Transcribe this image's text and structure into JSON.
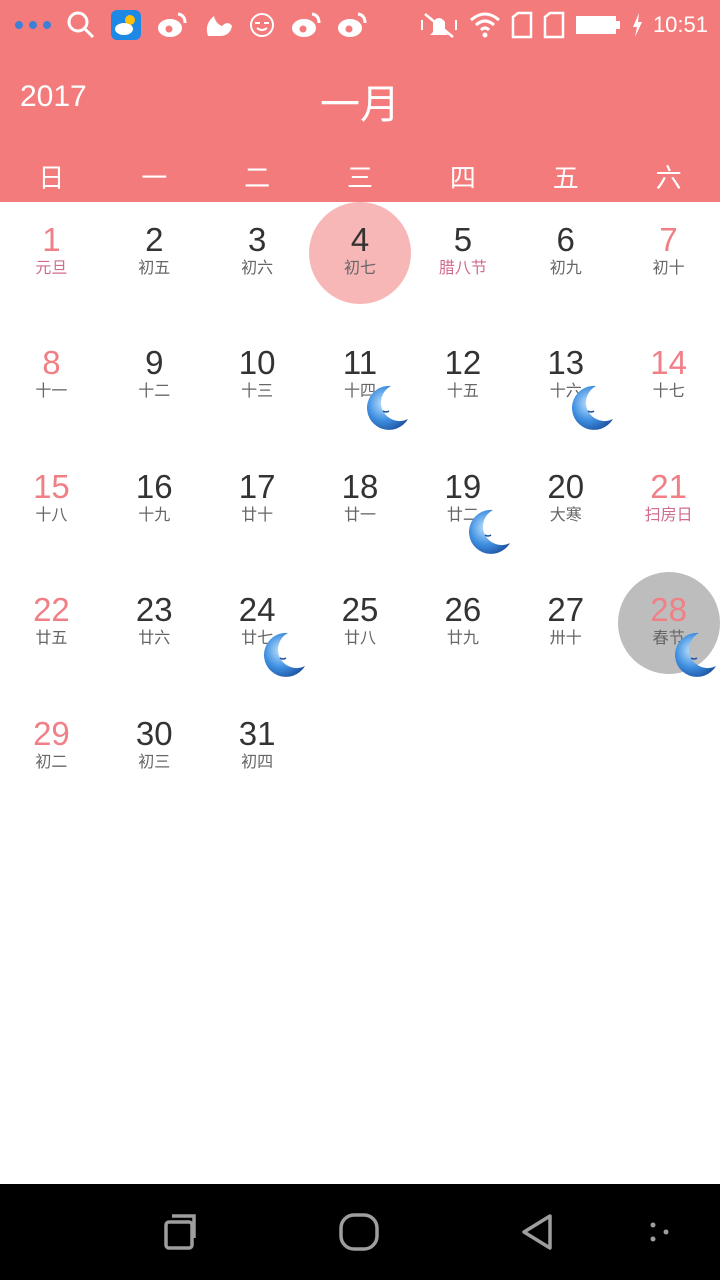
{
  "status_bar": {
    "time": "10:51",
    "left_icons": [
      "more-dots-icon",
      "search-icon",
      "weather-app-icon",
      "weibo-icon",
      "uc-browser-icon",
      "face-app-icon",
      "weibo-icon",
      "weibo-icon"
    ],
    "right_icons": [
      "mute-vibrate-icon",
      "wifi-icon",
      "sim-card-icon",
      "sim-card-icon",
      "battery-icon",
      "charging-icon"
    ]
  },
  "header": {
    "year": "2017",
    "month": "一月"
  },
  "weekdays": [
    "日",
    "一",
    "二",
    "三",
    "四",
    "五",
    "六"
  ],
  "days": [
    {
      "day": "1",
      "lunar": "元旦",
      "festival": true,
      "weekend": true,
      "row": 0,
      "col": 0
    },
    {
      "day": "2",
      "lunar": "初五",
      "row": 0,
      "col": 1
    },
    {
      "day": "3",
      "lunar": "初六",
      "row": 0,
      "col": 2
    },
    {
      "day": "4",
      "lunar": "初七",
      "row": 0,
      "col": 3,
      "today": true
    },
    {
      "day": "5",
      "lunar": "腊八节",
      "festival": true,
      "row": 0,
      "col": 4
    },
    {
      "day": "6",
      "lunar": "初九",
      "row": 0,
      "col": 5
    },
    {
      "day": "7",
      "lunar": "初十",
      "weekend": true,
      "row": 0,
      "col": 6
    },
    {
      "day": "8",
      "lunar": "十一",
      "weekend": true,
      "row": 1,
      "col": 0
    },
    {
      "day": "9",
      "lunar": "十二",
      "row": 1,
      "col": 1
    },
    {
      "day": "10",
      "lunar": "十三",
      "row": 1,
      "col": 2
    },
    {
      "day": "11",
      "lunar": "十四",
      "row": 1,
      "col": 3,
      "moon": true
    },
    {
      "day": "12",
      "lunar": "十五",
      "row": 1,
      "col": 4
    },
    {
      "day": "13",
      "lunar": "十六",
      "row": 1,
      "col": 5,
      "moon": true
    },
    {
      "day": "14",
      "lunar": "十七",
      "weekend": true,
      "row": 1,
      "col": 6
    },
    {
      "day": "15",
      "lunar": "十八",
      "weekend": true,
      "row": 2,
      "col": 0
    },
    {
      "day": "16",
      "lunar": "十九",
      "row": 2,
      "col": 1
    },
    {
      "day": "17",
      "lunar": "廿十",
      "row": 2,
      "col": 2
    },
    {
      "day": "18",
      "lunar": "廿一",
      "row": 2,
      "col": 3
    },
    {
      "day": "19",
      "lunar": "廿二",
      "row": 2,
      "col": 4,
      "moon": true
    },
    {
      "day": "20",
      "lunar": "大寒",
      "row": 2,
      "col": 5
    },
    {
      "day": "21",
      "lunar": "扫房日",
      "festival": true,
      "weekend": true,
      "row": 2,
      "col": 6
    },
    {
      "day": "22",
      "lunar": "廿五",
      "weekend": true,
      "row": 3,
      "col": 0
    },
    {
      "day": "23",
      "lunar": "廿六",
      "row": 3,
      "col": 1
    },
    {
      "day": "24",
      "lunar": "廿七",
      "row": 3,
      "col": 2,
      "moon": true
    },
    {
      "day": "25",
      "lunar": "廿八",
      "row": 3,
      "col": 3
    },
    {
      "day": "26",
      "lunar": "廿九",
      "row": 3,
      "col": 4
    },
    {
      "day": "27",
      "lunar": "卅十",
      "row": 3,
      "col": 5
    },
    {
      "day": "28",
      "lunar": "春节",
      "weekend": true,
      "row": 3,
      "col": 6,
      "selected": true,
      "moon": true
    },
    {
      "day": "29",
      "lunar": "初二",
      "weekend": true,
      "row": 4,
      "col": 0
    },
    {
      "day": "30",
      "lunar": "初三",
      "row": 4,
      "col": 1
    },
    {
      "day": "31",
      "lunar": "初四",
      "row": 4,
      "col": 2
    }
  ],
  "colors": {
    "header_bg": "#f47b7b",
    "weekend_text": "#f07f86",
    "festival_text": "#d06b8c",
    "today_circle": "#f8b7b7",
    "selected_circle": "#bdbdbd"
  },
  "nav_bar": {
    "buttons": [
      "recents-icon",
      "home-icon",
      "back-icon",
      "menu-dots-icon"
    ]
  }
}
